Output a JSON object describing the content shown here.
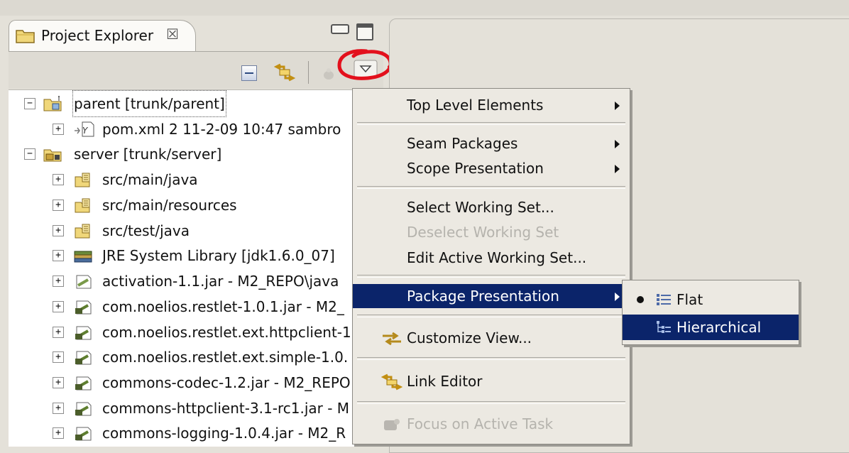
{
  "view": {
    "title": "Project Explorer",
    "close_glyph": "☒"
  },
  "tree": {
    "rows": [
      {
        "expander": "−",
        "label": "parent [trunk/parent]",
        "icon": "project-folder-icon"
      },
      {
        "expander": "+",
        "label": "pom.xml 2  11-2-09 10:47  sambro",
        "icon": "xml-file-icon"
      },
      {
        "expander": "−",
        "label": "server [trunk/server]",
        "icon": "project-folder-icon"
      },
      {
        "expander": "+",
        "label": "src/main/java",
        "icon": "source-folder-icon"
      },
      {
        "expander": "+",
        "label": "src/main/resources",
        "icon": "source-folder-icon"
      },
      {
        "expander": "+",
        "label": "src/test/java",
        "icon": "source-folder-icon"
      },
      {
        "expander": "+",
        "label": "JRE System Library [jdk1.6.0_07]",
        "icon": "library-icon"
      },
      {
        "expander": "+",
        "label": "activation-1.1.jar - M2_REPO\\java",
        "icon": "jar-icon"
      },
      {
        "expander": "+",
        "label": "com.noelios.restlet-1.0.1.jar - M2_",
        "icon": "jar-icon"
      },
      {
        "expander": "+",
        "label": "com.noelios.restlet.ext.httpclient-1",
        "icon": "jar-icon"
      },
      {
        "expander": "+",
        "label": "com.noelios.restlet.ext.simple-1.0.",
        "icon": "jar-icon"
      },
      {
        "expander": "+",
        "label": "commons-codec-1.2.jar - M2_REPO",
        "icon": "jar-icon"
      },
      {
        "expander": "+",
        "label": "commons-httpclient-3.1-rc1.jar - M",
        "icon": "jar-icon"
      },
      {
        "expander": "+",
        "label": "commons-logging-1.0.4.jar - M2_R",
        "icon": "jar-icon"
      }
    ]
  },
  "menu": {
    "top_level": "Top Level Elements",
    "seam_packages": "Seam Packages",
    "scope_presentation": "Scope Presentation",
    "select_ws": "Select Working Set...",
    "deselect_ws": "Deselect Working Set",
    "edit_ws": "Edit Active Working Set...",
    "package_presentation": "Package Presentation",
    "customize_view": "Customize View...",
    "link_editor": "Link Editor",
    "focus_active_task": "Focus on Active Task"
  },
  "submenu": {
    "flat": "Flat",
    "hierarchical": "Hierarchical",
    "selected": "Flat"
  },
  "colors": {
    "highlight": "#0b246a",
    "annotation": "#e3101c"
  }
}
